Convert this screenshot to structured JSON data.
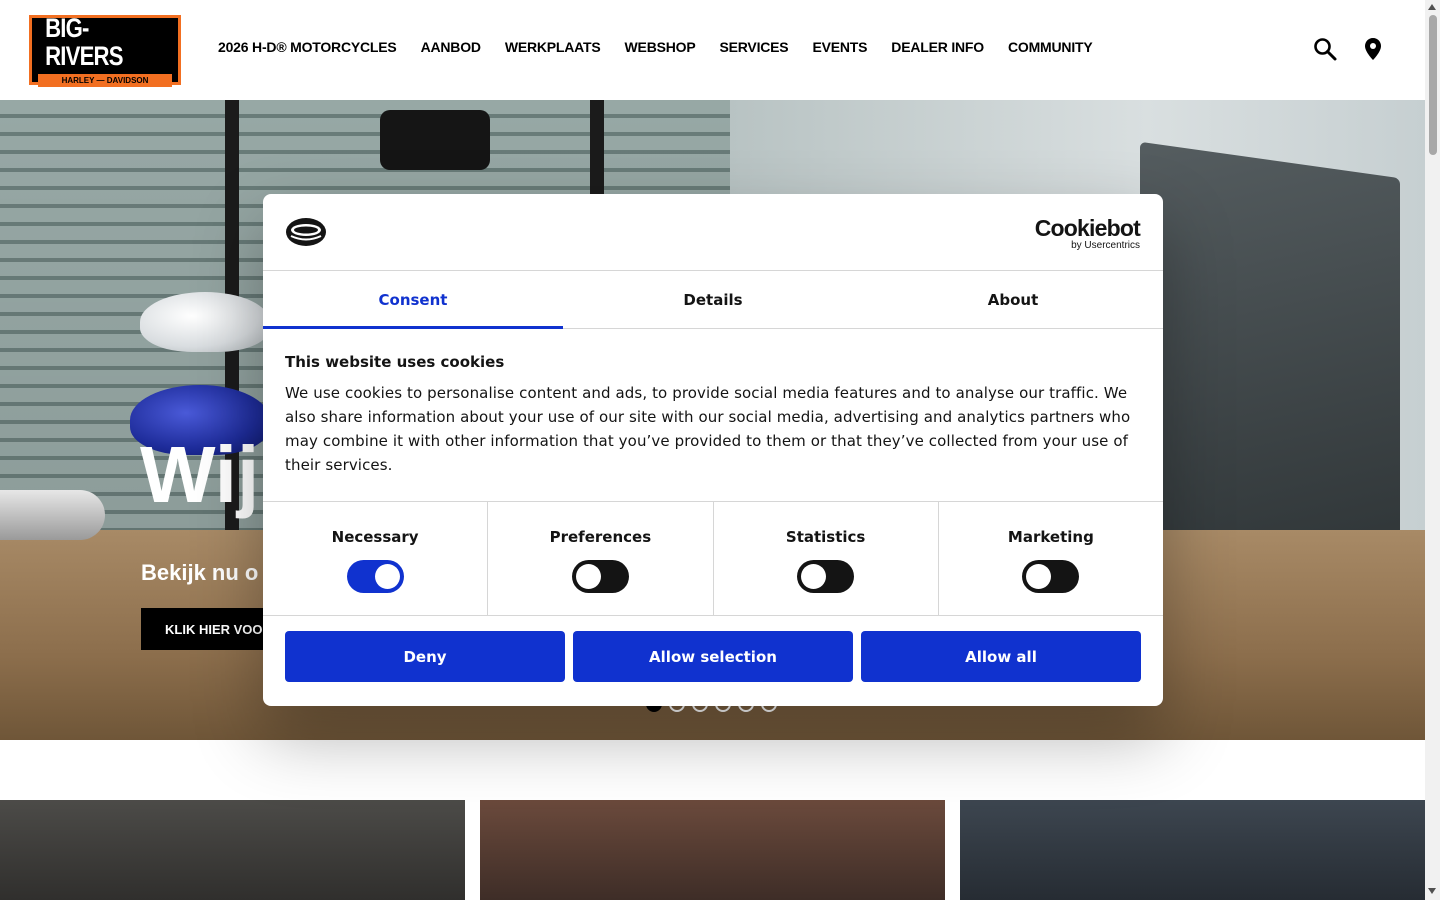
{
  "header": {
    "logo_main": "BIG-RIVERS",
    "logo_sub": "HARLEY — DAVIDSON",
    "nav": [
      "2026 H-D® MOTORCYCLES",
      "AANBOD",
      "WERKPLAATS",
      "WEBSHOP",
      "SERVICES",
      "EVENTS",
      "DEALER INFO",
      "COMMUNITY"
    ],
    "icons": [
      "search-icon",
      "location-pin-icon"
    ]
  },
  "hero": {
    "title": "Wij",
    "subtitle": "Bekijk nu o",
    "button": "KLIK HIER VOOR M",
    "slide_count": 6,
    "active_slide": 0
  },
  "cookie_dialog": {
    "brand": "Cookiebot",
    "brand_sub": "by Usercentrics",
    "tabs": [
      "Consent",
      "Details",
      "About"
    ],
    "active_tab": "Consent",
    "title": "This website uses cookies",
    "text": "We use cookies to personalise content and ads, to provide social media features and to analyse our traffic. We also share information about your use of our site with our social media, advertising and analytics partners who may combine it with other information that you’ve provided to them or that they’ve collected from your use of their services.",
    "preferences": [
      {
        "label": "Necessary",
        "enabled": true
      },
      {
        "label": "Preferences",
        "enabled": false
      },
      {
        "label": "Statistics",
        "enabled": false
      },
      {
        "label": "Marketing",
        "enabled": false
      }
    ],
    "buttons": {
      "deny": "Deny",
      "allow_selection": "Allow selection",
      "allow_all": "Allow all"
    },
    "accent_color": "#1032cf"
  },
  "colors": {
    "brand_orange": "#f26f21",
    "nav_text": "#000000"
  }
}
